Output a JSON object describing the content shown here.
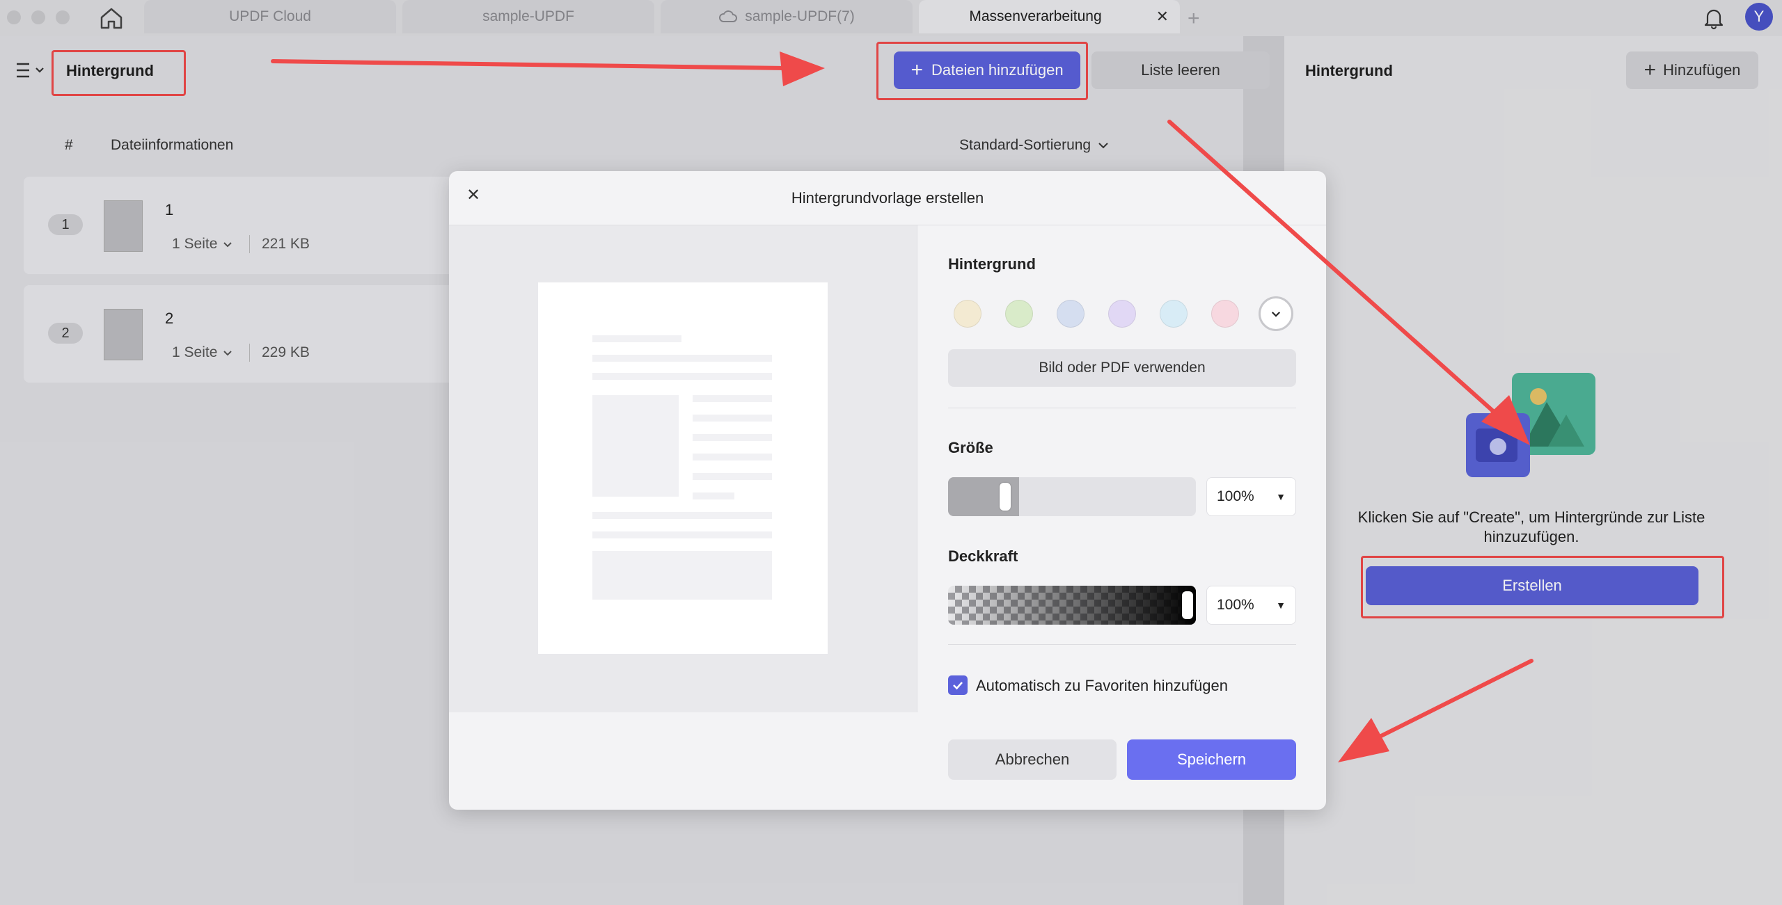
{
  "tabs": [
    {
      "label": "UPDF Cloud"
    },
    {
      "label": "sample-UPDF"
    },
    {
      "label": "sample-UPDF(7)"
    },
    {
      "label": "Massenverarbeitung"
    }
  ],
  "avatar_initial": "Y",
  "toolbar": {
    "title": "Hintergrund",
    "add_files_label": "Dateien hinzufügen",
    "clear_list_label": "Liste leeren"
  },
  "table": {
    "col_number": "#",
    "col_info": "Dateiinformationen",
    "sort_label": "Standard-Sortierung",
    "rows": [
      {
        "index": "1",
        "name": "1",
        "pages": "1 Seite",
        "size": "221 KB"
      },
      {
        "index": "2",
        "name": "2",
        "pages": "1 Seite",
        "size": "229 KB"
      }
    ]
  },
  "right_panel": {
    "title": "Hintergrund",
    "add_label": "Hinzufügen",
    "empty_text": "Klicken Sie auf \"Create\", um Hintergründe zur Liste hinzuzufügen.",
    "create_label": "Erstellen"
  },
  "modal": {
    "title": "Hintergrundvorlage erstellen",
    "background_label": "Hintergrund",
    "swatches": [
      "#f3ead2",
      "#d9ebc9",
      "#d5def0",
      "#e1d8f5",
      "#d8ecf6",
      "#f7d8e0"
    ],
    "use_image_label": "Bild oder PDF verwenden",
    "size_label": "Größe",
    "size_value": "100%",
    "size_level": 0.2,
    "opacity_label": "Deckkraft",
    "opacity_value": "100%",
    "opacity_level": 1.0,
    "favorite_label": "Automatisch zu Favoriten hinzufügen",
    "favorite_checked": true,
    "cancel_label": "Abbrechen",
    "save_label": "Speichern"
  },
  "colors": {
    "accent": "#5b61db",
    "annotation_red": "#ef4a4a"
  }
}
